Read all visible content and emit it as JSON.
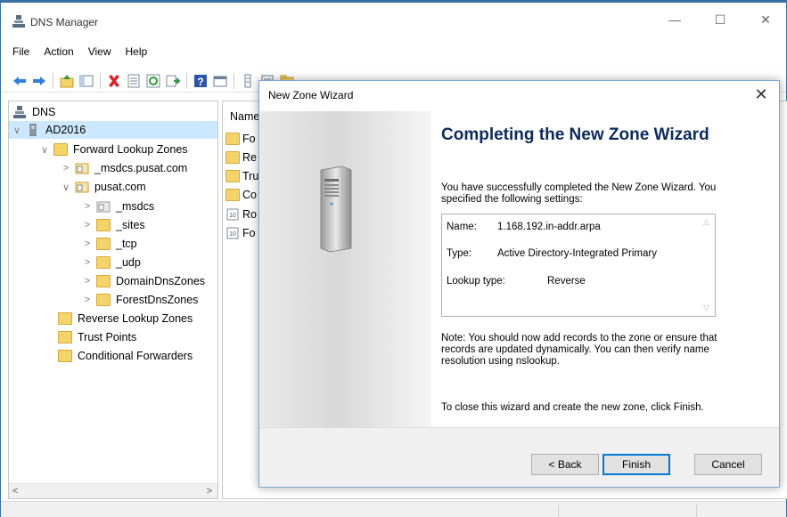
{
  "window": {
    "title": "DNS Manager",
    "minimize": "—",
    "maximize": "☐",
    "close": "✕"
  },
  "menu": [
    "File",
    "Action",
    "View",
    "Help"
  ],
  "toolbar_icons": [
    "back-icon",
    "forward-icon",
    "up-folder-icon",
    "show-hide-tree-icon",
    "delete-icon",
    "properties-icon",
    "refresh-icon",
    "export-icon",
    "help-icon",
    "view-icon",
    "record-icon",
    "list-icon",
    "folder-icon"
  ],
  "tree": {
    "root": "DNS",
    "server": "AD2016",
    "forward": "Forward Lookup Zones",
    "msdcs_zone": "_msdcs.pusat.com",
    "pusat": "pusat.com",
    "children": [
      "_msdcs",
      "_sites",
      "_tcp",
      "_udp",
      "DomainDnsZones",
      "ForestDnsZones"
    ],
    "reverse": "Reverse Lookup Zones",
    "trust": "Trust Points",
    "conditional": "Conditional Forwarders"
  },
  "list": {
    "header": "Name",
    "rows": [
      "Fo",
      "Re",
      "Tru",
      "Co",
      "Ro",
      "Fo"
    ]
  },
  "dialog": {
    "title": "New Zone Wizard",
    "close": "✕",
    "heading": "Completing the New Zone Wizard",
    "intro": "You have successfully completed the New Zone Wizard. You specified the following settings:",
    "settings": {
      "name_label": "Name:",
      "name_value": "1.168.192.in-addr.arpa",
      "type_label": "Type:",
      "type_value": "Active Directory-Integrated Primary",
      "lookup_label": "Lookup type:",
      "lookup_value": "Reverse"
    },
    "note": "Note: You should now add records to the zone or ensure that records are updated dynamically. You can then verify name resolution using nslookup.",
    "closing": "To close this wizard and create the new zone, click Finish.",
    "buttons": {
      "back": "< Back",
      "finish": "Finish",
      "cancel": "Cancel"
    }
  }
}
